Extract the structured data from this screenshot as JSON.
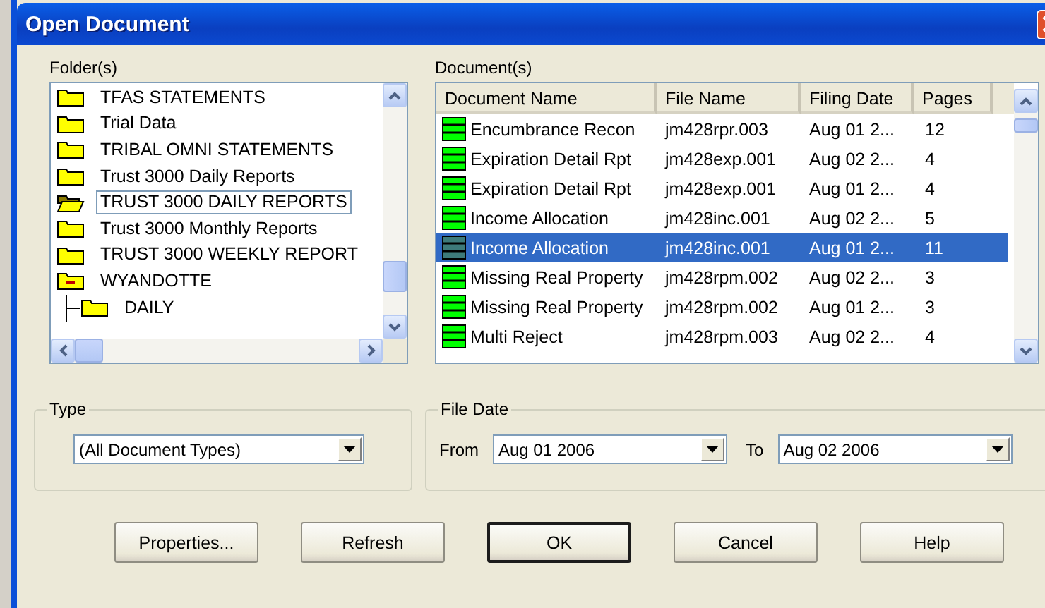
{
  "window": {
    "title": "Open Document"
  },
  "folders": {
    "label": "Folder(s)",
    "items": [
      {
        "name": "TFAS STATEMENTS",
        "selected": false
      },
      {
        "name": "Trial Data",
        "selected": false
      },
      {
        "name": "TRIBAL OMNI STATEMENTS",
        "selected": false
      },
      {
        "name": "Trust 3000 Daily Reports",
        "selected": false
      },
      {
        "name": "TRUST 3000 DAILY REPORTS",
        "selected": true
      },
      {
        "name": "Trust 3000 Monthly Reports",
        "selected": false
      },
      {
        "name": "TRUST 3000 WEEKLY REPORT",
        "selected": false
      },
      {
        "name": "WYANDOTTE",
        "selected": false,
        "expanded": true,
        "children": [
          {
            "name": "DAILY",
            "selected": false
          }
        ]
      }
    ]
  },
  "documents": {
    "label": "Document(s)",
    "columns": [
      "Document Name",
      "File Name",
      "Filing Date",
      "Pages"
    ],
    "rows": [
      {
        "cells": [
          "Encumbrance Recon",
          "jm428rpr.003",
          "Aug 01 2...",
          "12"
        ],
        "selected": false
      },
      {
        "cells": [
          "Expiration Detail Rpt",
          "jm428exp.001",
          "Aug 02 2...",
          "4"
        ],
        "selected": false
      },
      {
        "cells": [
          "Expiration Detail Rpt",
          "jm428exp.001",
          "Aug 01 2...",
          "4"
        ],
        "selected": false
      },
      {
        "cells": [
          "Income Allocation",
          "jm428inc.001",
          "Aug 02 2...",
          "5"
        ],
        "selected": false
      },
      {
        "cells": [
          "Income Allocation",
          "jm428inc.001",
          "Aug 01 2...",
          "11"
        ],
        "selected": true
      },
      {
        "cells": [
          "Missing Real Property",
          "jm428rpm.002",
          "Aug 02 2...",
          "3"
        ],
        "selected": false
      },
      {
        "cells": [
          "Missing Real Property",
          "jm428rpm.002",
          "Aug 01 2...",
          "3"
        ],
        "selected": false
      },
      {
        "cells": [
          "Multi Reject",
          "jm428rpm.003",
          "Aug 02 2...",
          "4"
        ],
        "selected": false
      }
    ]
  },
  "type": {
    "label": "Type",
    "value": "(All Document Types)"
  },
  "file_date": {
    "label": "File Date",
    "from_label": "From",
    "from": "Aug 01 2006",
    "to_label": "To",
    "to": "Aug 02 2006"
  },
  "buttons": [
    {
      "label": "Properties...",
      "default": false
    },
    {
      "label": "Refresh",
      "default": false
    },
    {
      "label": "OK",
      "default": true
    },
    {
      "label": "Cancel",
      "default": false
    },
    {
      "label": "Help",
      "default": false
    }
  ]
}
